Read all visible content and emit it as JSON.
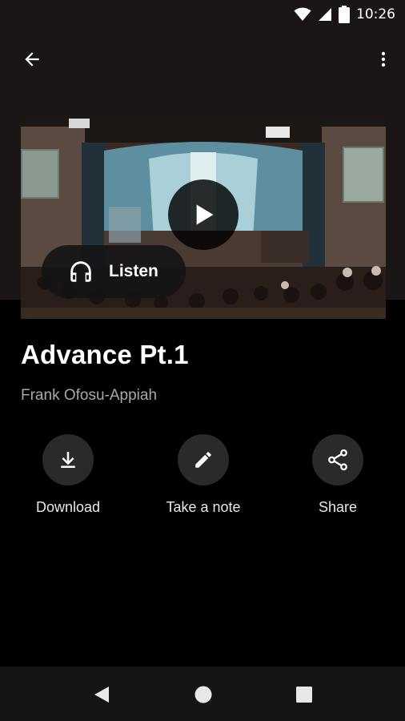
{
  "status_bar": {
    "time": "10:26",
    "icons": [
      "wifi-icon",
      "cell-signal-icon",
      "battery-icon"
    ]
  },
  "app_bar": {
    "back_icon": "arrow-back-icon",
    "more_icon": "more-vert-icon"
  },
  "player": {
    "play_icon": "play-icon",
    "listen_label": "Listen",
    "listen_icon": "headphones-icon"
  },
  "sermon": {
    "title": "Advance Pt.1",
    "author": "Frank Ofosu-Appiah"
  },
  "actions": [
    {
      "label": "Download",
      "icon": "download-icon"
    },
    {
      "label": "Take a note",
      "icon": "pencil-icon"
    },
    {
      "label": "Share",
      "icon": "share-icon"
    }
  ],
  "nav_bar": {
    "icons": [
      "nav-back-icon",
      "nav-home-icon",
      "nav-recents-icon"
    ]
  },
  "colors": {
    "header_bg": "#1a1616",
    "body_bg": "#000000",
    "button_bg": "#2a2a2a",
    "secondary_text": "#a8a8a8"
  }
}
